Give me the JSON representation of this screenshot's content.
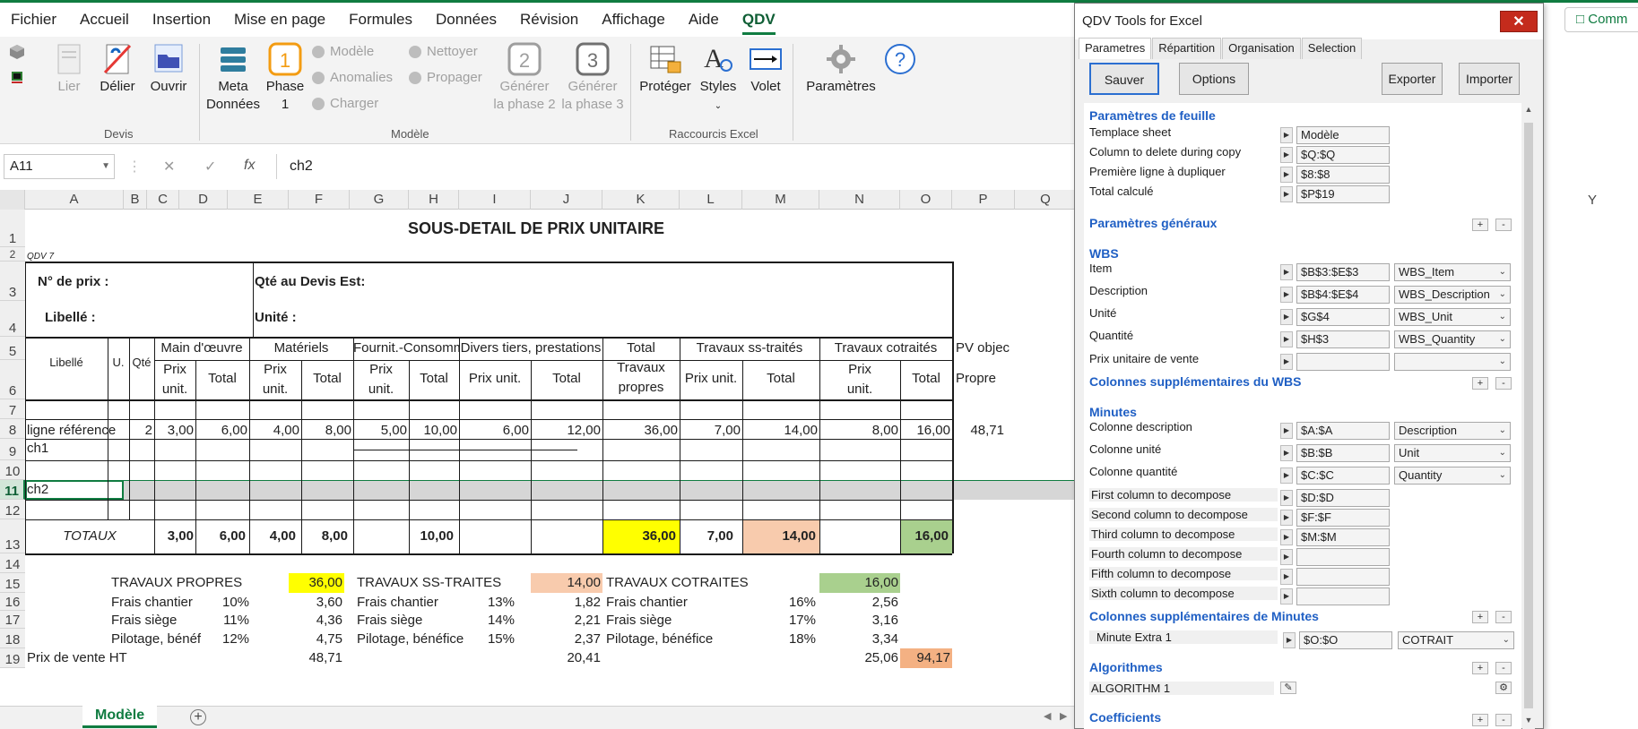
{
  "ribbon_tabs": [
    "Fichier",
    "Accueil",
    "Insertion",
    "Mise en page",
    "Formules",
    "Données",
    "Révision",
    "Affichage",
    "Aide",
    "QDV"
  ],
  "ribbon": {
    "lier": "Lier",
    "delier": "Délier",
    "ouvrir": "Ouvrir",
    "meta_line1": "Meta",
    "meta_line2": "Données",
    "phase1_line1": "Phase",
    "phase1_line2": "1",
    "modele": "Modèle",
    "anomalies": "Anomalies",
    "charger": "Charger",
    "nettoyer": "Nettoyer",
    "propager": "Propager",
    "gen2_line1": "Générer",
    "gen2_line2": "la phase 2",
    "gen3_line1": "Générer",
    "gen3_line2": "la phase 3",
    "proteger": "Protéger",
    "styles": "Styles",
    "volet": "Volet",
    "parametres": "Paramètres",
    "group_devis": "Devis",
    "group_modele": "Modèle",
    "group_raccourcis": "Raccourcis Excel"
  },
  "formula_bar": {
    "name_box": "A11",
    "formula": "ch2"
  },
  "columns": [
    "A",
    "B",
    "C",
    "D",
    "E",
    "F",
    "G",
    "H",
    "I",
    "J",
    "K",
    "L",
    "M",
    "N",
    "O",
    "P",
    "Q",
    "Y"
  ],
  "rows": [
    "1",
    "2",
    "3",
    "4",
    "5",
    "6",
    "7",
    "8",
    "9",
    "10",
    "11",
    "12",
    "13",
    "14",
    "15",
    "16",
    "17",
    "18",
    "19"
  ],
  "sheet": {
    "title": "SOUS-DETAIL DE PRIX UNITAIRE",
    "qdv7": "QDV 7",
    "no_prix": "N° de prix :",
    "qte_devis": "Qté au Devis Est:",
    "libelle_lbl": "Libellé :",
    "unite_lbl": "Unité :",
    "hdr_libelle": "Libellé",
    "hdr_u": "U.",
    "hdr_qte": "Qté",
    "hdr_main": "Main d'œuvre",
    "hdr_materiels": "Matériels",
    "hdr_fournit": "Fournit.-Consomm",
    "hdr_divers": "Divers tiers, prestations",
    "hdr_total_top": "Total",
    "hdr_total_mid": "Travaux",
    "hdr_total_bot": "propres",
    "hdr_ss": "Travaux ss-traités",
    "hdr_cot": "Travaux cotraités",
    "hdr_pv": "PV objec",
    "hdr_propre": "Propre",
    "prix_a": "Prix",
    "prix_b": "unit.",
    "total": "Total",
    "prix_unit": "Prix unit.",
    "ref_label": "ligne référence",
    "ref_values": [
      "2",
      "3,00",
      "6,00",
      "4,00",
      "8,00",
      "5,00",
      "10,00",
      "6,00",
      "12,00",
      "36,00",
      "7,00",
      "14,00",
      "8,00",
      "16,00",
      "48,71"
    ],
    "ch1": "ch1",
    "ch2": "ch2",
    "totaux": "TOTAUX",
    "tot_values": [
      "3,00",
      "6,00",
      "4,00",
      "8,00",
      "10,00",
      "36,00",
      "7,00",
      "14,00",
      "16,00"
    ],
    "tp": "TRAVAUX PROPRES",
    "tp_val": "36,00",
    "tss": "TRAVAUX SS-TRAITES",
    "tss_val": "14,00",
    "tc": "TRAVAUX COTRAITES",
    "tc_val": "16,00",
    "frais_chantier": "Frais chantier",
    "frais_siege": "Frais siège",
    "pilotage_short": "Pilotage, bénéf",
    "pilotage": "Pilotage, bénéfice",
    "tp_pcts": [
      "10%",
      "11%",
      "12%"
    ],
    "tp_amts": [
      "3,60",
      "4,36",
      "4,75"
    ],
    "tss_pcts": [
      "13%",
      "14%",
      "15%"
    ],
    "tss_amts": [
      "1,82",
      "2,21",
      "2,37"
    ],
    "tc_pcts": [
      "16%",
      "17%",
      "18%"
    ],
    "tc_amts": [
      "2,56",
      "3,16",
      "3,34"
    ],
    "pv_ht": "Prix de vente HT",
    "pv_values": [
      "48,71",
      "20,41",
      "25,06",
      "94,17"
    ]
  },
  "sheet_tab": "Modèle",
  "comm_button": "Comm",
  "panel": {
    "title": "QDV Tools for Excel",
    "tabs": [
      "Parametres",
      "Répartition",
      "Organisation",
      "Selection"
    ],
    "btn_save": "Sauver",
    "btn_options": "Options",
    "btn_export": "Exporter",
    "btn_import": "Importer",
    "sec_feuille": "Paramètres de feuille",
    "feuille_rows": [
      {
        "label": "Templace sheet",
        "value": "Modèle"
      },
      {
        "label": "Column to delete during copy",
        "value": "$Q:$Q"
      },
      {
        "label": "Première ligne à dupliquer",
        "value": "$8:$8"
      },
      {
        "label": "Total calculé",
        "value": "$P$19"
      }
    ],
    "sec_generaux": "Paramètres généraux",
    "sec_wbs": "WBS",
    "wbs_rows": [
      {
        "label": "Item",
        "value": "$B$3:$E$3",
        "combo": "WBS_Item"
      },
      {
        "label": "Description",
        "value": "$B$4:$E$4",
        "combo": "WBS_Description"
      },
      {
        "label": "Unité",
        "value": "$G$4",
        "combo": "WBS_Unit"
      },
      {
        "label": "Quantité",
        "value": "$H$3",
        "combo": "WBS_Quantity"
      },
      {
        "label": "Prix unitaire de vente",
        "value": "",
        "combo": ""
      }
    ],
    "sec_cols_wbs": "Colonnes supplémentaires du WBS",
    "sec_minutes": "Minutes",
    "minutes_rows": [
      {
        "label": "Colonne description",
        "value": "$A:$A",
        "combo": "Description"
      },
      {
        "label": "Colonne unité",
        "value": "$B:$B",
        "combo": "Unit"
      },
      {
        "label": "Colonne quantité",
        "value": "$C:$C",
        "combo": "Quantity"
      }
    ],
    "decompose_rows": [
      {
        "label": "First column to decompose",
        "value": "$D:$D"
      },
      {
        "label": "Second column to decompose",
        "value": "$F:$F"
      },
      {
        "label": "Third column to decompose",
        "value": "$M:$M"
      },
      {
        "label": "Fourth column to decompose",
        "value": ""
      },
      {
        "label": "Fifth column to decompose",
        "value": ""
      },
      {
        "label": "Sixth column to decompose",
        "value": ""
      }
    ],
    "sec_cols_minutes": "Colonnes supplémentaires de Minutes",
    "extra": {
      "label": "Minute Extra 1",
      "value": "$O:$O",
      "combo": "COTRAIT"
    },
    "sec_algos": "Algorithmes",
    "algo1": "ALGORITHM 1",
    "sec_coeffs": "Coefficients"
  },
  "colors": {
    "excel_green": "#107c41",
    "yellow": "#ffff00",
    "salmon": "#f8cbad",
    "green_fill": "#a9d08e",
    "orange": "#f4b183",
    "panel_blue": "#1f5fc4",
    "close_red": "#c42b1c"
  }
}
